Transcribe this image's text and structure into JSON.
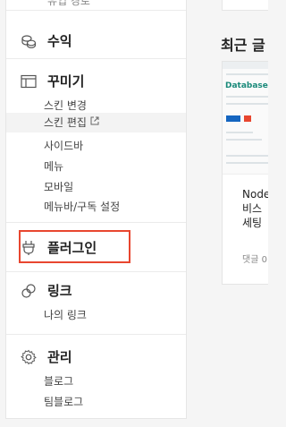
{
  "sidebar": {
    "cut_text": "유입 경로",
    "sections": {
      "revenue": {
        "label": "수익"
      },
      "decorate": {
        "label": "꾸미기",
        "items": [
          "스킨 변경",
          "스킨 편집",
          "사이드바",
          "메뉴",
          "모바일",
          "메뉴바/구독 설정"
        ]
      },
      "plugin": {
        "label": "플러그인"
      },
      "link": {
        "label": "링크",
        "items": [
          "나의 링크"
        ]
      },
      "manage": {
        "label": "관리",
        "items": [
          "블로그",
          "팀블로그"
        ]
      }
    }
  },
  "main": {
    "recent_title": "최근 글",
    "card": {
      "thumb_title": "Database U",
      "text_lines": [
        "Node",
        "비스",
        "세팅"
      ],
      "comments": "댓글 0"
    }
  },
  "colors": {
    "highlight": "#e8462f",
    "thumb_title": "#1a8a7a"
  }
}
